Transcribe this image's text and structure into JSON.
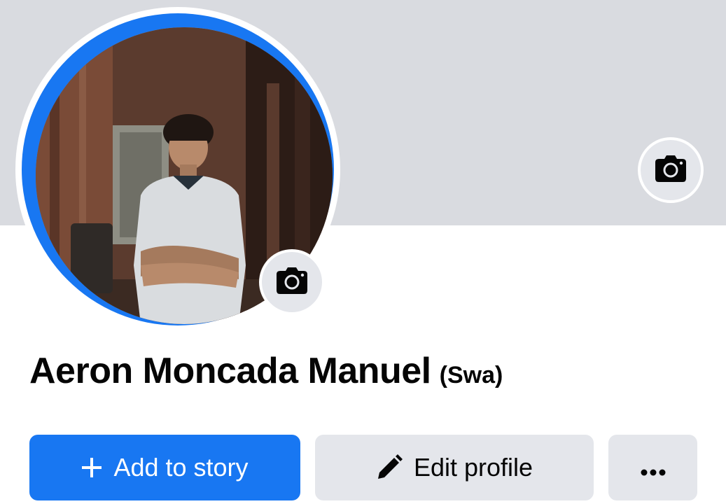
{
  "profile": {
    "name": "Aeron Moncada Manuel",
    "alternate_name": "(Swa)"
  },
  "actions": {
    "add_story_label": "Add to story",
    "edit_profile_label": "Edit profile"
  },
  "icons": {
    "cover_camera": "camera-icon",
    "avatar_camera": "camera-icon",
    "add_story": "plus-icon",
    "edit_profile": "pencil-icon",
    "more": "more-dots-icon"
  },
  "colors": {
    "brand_blue": "#1877f2",
    "cover_gray": "#d9dbe0",
    "button_gray": "#e4e6eb",
    "text": "#050505"
  }
}
